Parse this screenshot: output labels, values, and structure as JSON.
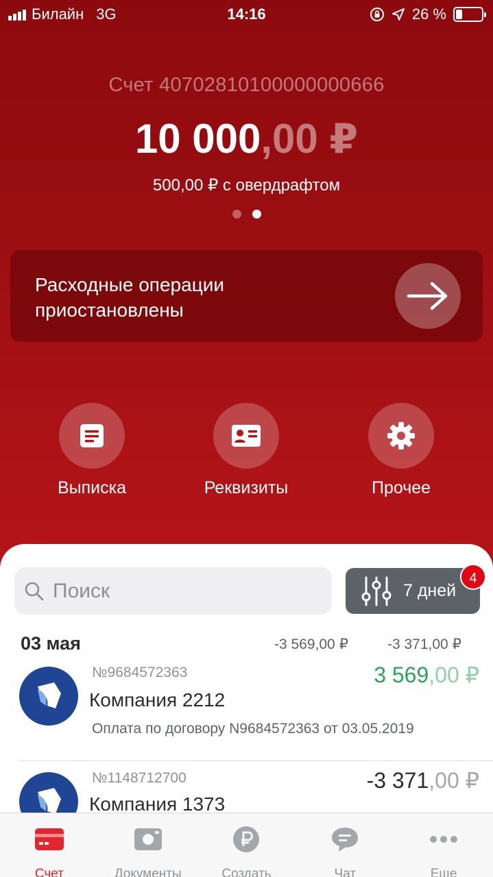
{
  "status_bar": {
    "carrier": "Билайн",
    "network": "3G",
    "time": "14:16",
    "battery": "26 %",
    "battery_level": 0.26
  },
  "account": {
    "label": "Счет 40702810100000000666",
    "balance_int": "10 000",
    "balance_frac": ",00 ₽",
    "overdraft": "500,00 ₽ с овердрафтом",
    "page_count": 2,
    "active_page": 2
  },
  "alert": {
    "text": "Расходные операции приостановлены",
    "icon": "arrow-right-icon"
  },
  "actions": [
    {
      "label": "Выписка",
      "icon": "statement-icon"
    },
    {
      "label": "Реквизиты",
      "icon": "requisites-icon"
    },
    {
      "label": "Прочее",
      "icon": "gear-icon"
    }
  ],
  "search": {
    "placeholder": "Поиск",
    "value": ""
  },
  "filter": {
    "label": "7 дней",
    "badge": "4",
    "icon": "sliders-icon"
  },
  "transactions_group": {
    "date": "03 мая",
    "sum_out": "-3 569,00 ₽",
    "sum_in": "-3 371,00 ₽"
  },
  "transactions": [
    {
      "number": "№9684572363",
      "name": "Компания 2212",
      "description": "Оплата по договору N9684572363 от 03.05.2019",
      "amount_int": "3 569",
      "amount_frac": ",00 ₽",
      "kind": "income"
    },
    {
      "number": "№1148712700",
      "name": "Компания 1373",
      "description": "",
      "amount_int": "-3 371",
      "amount_frac": ",00 ₽",
      "kind": "expense"
    }
  ],
  "tabs": [
    {
      "label": "Счет",
      "icon": "card-icon",
      "active": true
    },
    {
      "label": "Документы",
      "icon": "documents-icon",
      "active": false
    },
    {
      "label": "Создать",
      "icon": "ruble-icon",
      "active": false
    },
    {
      "label": "Чат",
      "icon": "chat-icon",
      "active": false
    },
    {
      "label": "Еще",
      "icon": "more-icon",
      "active": false
    }
  ],
  "colors": {
    "brand_red": "#b51519",
    "income_green": "#2fa35a",
    "active_tab": "#e3262d",
    "badge": "#e30613"
  }
}
